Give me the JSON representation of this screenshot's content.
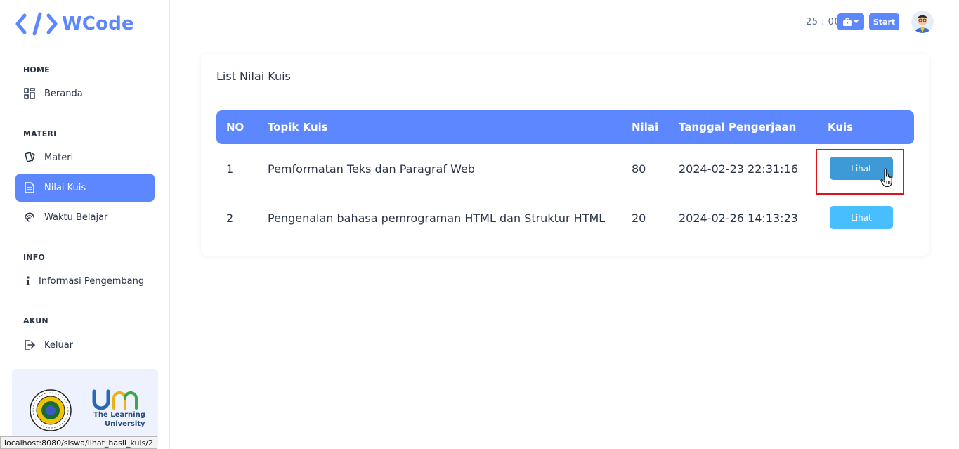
{
  "brand": {
    "name": "WCode"
  },
  "sidebar": {
    "sections": [
      {
        "label": "HOME",
        "items": [
          {
            "label": "Beranda",
            "icon": "dashboard-icon"
          }
        ]
      },
      {
        "label": "MATERI",
        "items": [
          {
            "label": "Materi",
            "icon": "cards-icon"
          },
          {
            "label": "Nilai Kuis",
            "icon": "file-text-icon",
            "active": true
          },
          {
            "label": "Waktu Belajar",
            "icon": "fingerprint-icon"
          }
        ]
      },
      {
        "label": "INFO",
        "items": [
          {
            "label": "Informasi Pengembang",
            "icon": "info-icon"
          }
        ]
      },
      {
        "label": "AKUN",
        "items": [
          {
            "label": "Keluar",
            "icon": "logout-icon"
          }
        ]
      }
    ],
    "university": {
      "tagline_1": "The Learning",
      "tagline_2": "University",
      "seal_text": "UNIVERSITAS NEGERI MALANG"
    }
  },
  "header": {
    "timer": "25 : 00",
    "start_label": "Start"
  },
  "main": {
    "card_title": "List Nilai Kuis",
    "table": {
      "columns": [
        "NO",
        "Topik Kuis",
        "Nilai",
        "Tanggal Pengerjaan",
        "Kuis"
      ],
      "rows": [
        {
          "no": "1",
          "topik": "Pemformatan Teks dan Paragraf Web",
          "nilai": "80",
          "tanggal": "2024-02-23 22:31:16",
          "action": "Lihat"
        },
        {
          "no": "2",
          "topik": "Pengenalan bahasa pemrograman HTML dan Struktur HTML",
          "nilai": "20",
          "tanggal": "2024-02-26 14:13:23",
          "action": "Lihat"
        }
      ]
    }
  },
  "status_url": "localhost:8080/siswa/lihat_hasil_kuis/2",
  "colors": {
    "primary": "#5d87ff",
    "hover_button": "#3d9ad6",
    "button": "#49beff",
    "highlight": "#e0121b"
  }
}
